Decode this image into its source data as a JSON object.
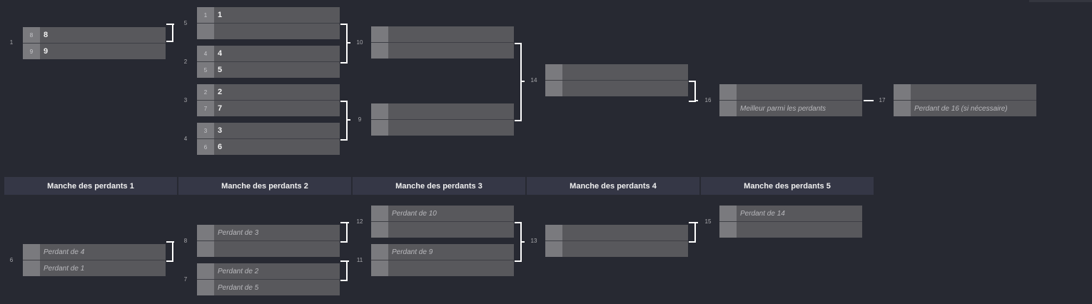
{
  "winners_matches": [
    {
      "num": "1",
      "top": {
        "seed": "8",
        "name": "8"
      },
      "bottom": {
        "seed": "9",
        "name": "9"
      }
    },
    {
      "num": "5",
      "top": {
        "seed": "1",
        "name": "1"
      },
      "bottom": {
        "seed": "",
        "name": ""
      }
    },
    {
      "num": "2",
      "top": {
        "seed": "4",
        "name": "4"
      },
      "bottom": {
        "seed": "5",
        "name": "5"
      }
    },
    {
      "num": "3",
      "top": {
        "seed": "2",
        "name": "2"
      },
      "bottom": {
        "seed": "7",
        "name": "7"
      }
    },
    {
      "num": "4",
      "top": {
        "seed": "3",
        "name": "3"
      },
      "bottom": {
        "seed": "6",
        "name": "6"
      }
    },
    {
      "num": "10",
      "top": {
        "seed": "",
        "name": ""
      },
      "bottom": {
        "seed": "",
        "name": ""
      }
    },
    {
      "num": "9",
      "top": {
        "seed": "",
        "name": ""
      },
      "bottom": {
        "seed": "",
        "name": ""
      }
    },
    {
      "num": "14",
      "top": {
        "seed": "",
        "name": ""
      },
      "bottom": {
        "seed": "",
        "name": ""
      }
    },
    {
      "num": "16",
      "top": {
        "seed": "",
        "name": ""
      },
      "bottom": {
        "seed": "",
        "name": "Meilleur parmi les perdants"
      }
    },
    {
      "num": "17",
      "top": {
        "seed": "",
        "name": ""
      },
      "bottom": {
        "seed": "",
        "name": "Perdant de 16 (si nécessaire)"
      }
    }
  ],
  "losers_rounds": [
    "Manche des perdants 1",
    "Manche des perdants 2",
    "Manche des perdants 3",
    "Manche des perdants 4",
    "Manche des perdants 5"
  ],
  "losers_matches": [
    {
      "num": "6",
      "top": {
        "seed": "",
        "name": "Perdant de 4"
      },
      "bottom": {
        "seed": "",
        "name": "Perdant de 1"
      }
    },
    {
      "num": "8",
      "top": {
        "seed": "",
        "name": "Perdant de 3"
      },
      "bottom": {
        "seed": "",
        "name": ""
      }
    },
    {
      "num": "7",
      "top": {
        "seed": "",
        "name": "Perdant de 2"
      },
      "bottom": {
        "seed": "",
        "name": "Perdant de 5"
      }
    },
    {
      "num": "12",
      "top": {
        "seed": "",
        "name": "Perdant de 10"
      },
      "bottom": {
        "seed": "",
        "name": ""
      }
    },
    {
      "num": "11",
      "top": {
        "seed": "",
        "name": "Perdant de 9"
      },
      "bottom": {
        "seed": "",
        "name": ""
      }
    },
    {
      "num": "13",
      "top": {
        "seed": "",
        "name": ""
      },
      "bottom": {
        "seed": "",
        "name": ""
      }
    },
    {
      "num": "15",
      "top": {
        "seed": "",
        "name": "Perdant de 14"
      },
      "bottom": {
        "seed": "",
        "name": ""
      }
    }
  ],
  "colors": {
    "background": "#272932",
    "slot": "#58585c",
    "seed_box": "#7a7a7e",
    "round_header": "#353746",
    "connector": "#ffffff"
  }
}
